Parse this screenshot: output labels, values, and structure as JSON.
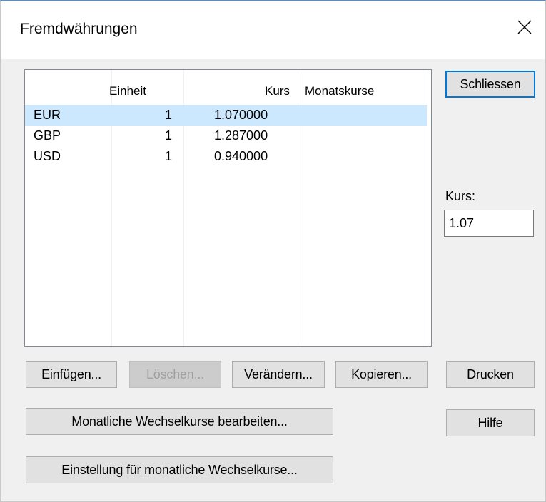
{
  "window": {
    "title": "Fremdwährungen"
  },
  "table": {
    "headers": {
      "col0": "",
      "col1": "Einheit",
      "col2": "Kurs",
      "col3": "Monatskurse"
    },
    "rows": [
      {
        "code": "EUR",
        "unit": "1",
        "rate": "1.070000",
        "monthly": "",
        "selected": true
      },
      {
        "code": "GBP",
        "unit": "1",
        "rate": "1.287000",
        "monthly": "",
        "selected": false
      },
      {
        "code": "USD",
        "unit": "1",
        "rate": "0.940000",
        "monthly": "",
        "selected": false
      }
    ]
  },
  "buttons": {
    "close": "Schliessen",
    "insert": "Einfügen...",
    "delete": "Löschen...",
    "change": "Verändern...",
    "copy": "Kopieren...",
    "print": "Drucken",
    "monthly_edit": "Monatliche Wechselkurse bearbeiten...",
    "help": "Hilfe",
    "monthly_settings": "Einstellung für monatliche Wechselkurse..."
  },
  "kurs": {
    "label": "Kurs:",
    "value": "1.07"
  },
  "colors": {
    "selection": "#cce8ff",
    "accent": "#0078d7"
  }
}
